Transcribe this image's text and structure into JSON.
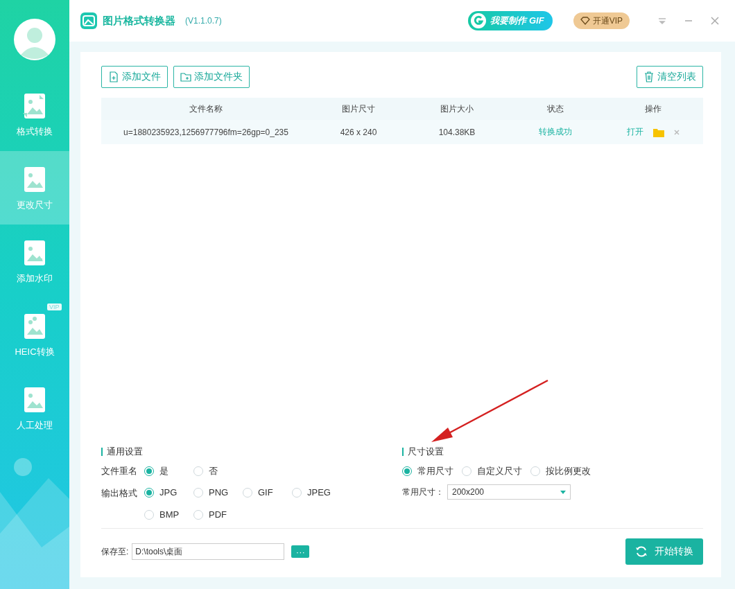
{
  "app": {
    "title": "图片格式转换器",
    "version": "(V1.1.0.7)"
  },
  "header": {
    "gif_button": "我要制作 GIF",
    "vip_button": "开通VIP"
  },
  "sidebar": {
    "items": [
      {
        "label": "格式转换",
        "selected": false
      },
      {
        "label": "更改尺寸",
        "selected": true
      },
      {
        "label": "添加水印",
        "selected": false
      },
      {
        "label": "HEIC转换",
        "selected": false,
        "badge": "VIP"
      },
      {
        "label": "人工处理",
        "selected": false
      }
    ]
  },
  "toolbar": {
    "buttons": [
      "添加文件",
      "添加文件夹"
    ],
    "clear_button": "清空列表"
  },
  "table": {
    "columns": [
      "文件名称",
      "图片尺寸",
      "图片大小",
      "状态",
      "操作"
    ],
    "rows": [
      {
        "file_name": "u=1880235923,1256977796fm=26gp=0_235",
        "dimensions": "426 x 240",
        "file_size": "104.38KB",
        "status": "转换成功",
        "open_link": "打开"
      }
    ]
  },
  "general_settings": {
    "title": "通用设置",
    "rename": {
      "label": "文件重名",
      "options": [
        {
          "label": "是",
          "selected": true
        },
        {
          "label": "否",
          "selected": false
        }
      ]
    },
    "output_format": {
      "label": "输出格式",
      "options": [
        {
          "label": "JPG",
          "selected": true
        },
        {
          "label": "PNG",
          "selected": false
        },
        {
          "label": "GIF",
          "selected": false
        },
        {
          "label": "JPEG",
          "selected": false
        },
        {
          "label": "BMP",
          "selected": false
        },
        {
          "label": "PDF",
          "selected": false
        }
      ]
    }
  },
  "size_settings": {
    "title": "尺寸设置",
    "modes": [
      {
        "label": "常用尺寸",
        "selected": true
      },
      {
        "label": "自定义尺寸",
        "selected": false
      },
      {
        "label": "按比例更改",
        "selected": false
      }
    ],
    "common_size": {
      "label": "常用尺寸：",
      "value": "200x200"
    }
  },
  "save": {
    "label": "保存至:",
    "path": "D:\\tools\\桌面",
    "browse_button": "···"
  },
  "start_button": "开始转换"
}
